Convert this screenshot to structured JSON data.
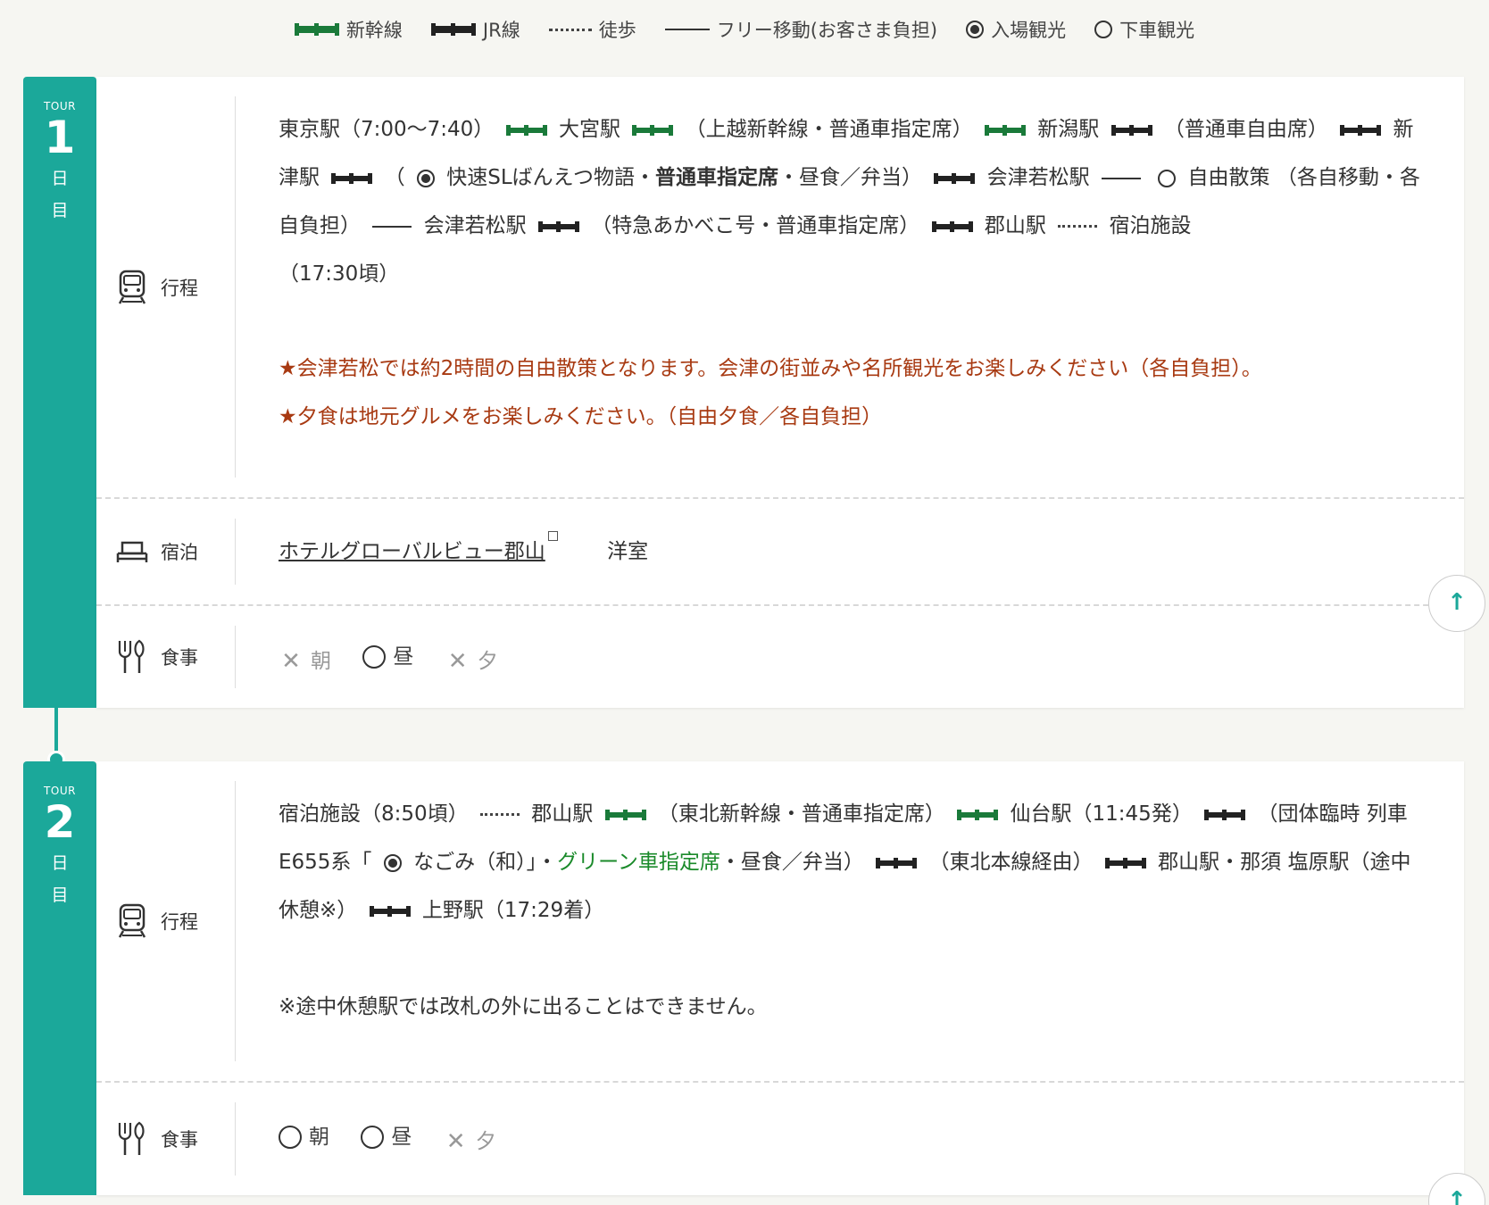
{
  "legend": {
    "shinkansen": "新幹線",
    "jr": "JR線",
    "walk": "徒歩",
    "free": "フリー移動(お客さま負担)",
    "entry": "入場観光",
    "stopover": "下車観光"
  },
  "colors": {
    "accent": "#1ba89a",
    "shinkansen": "#1a7a3a",
    "note": "#a83a12",
    "green_seat": "#1a8a2a"
  },
  "day1": {
    "tour": "TOUR",
    "num": "1",
    "nichi1": "日",
    "nichi2": "目",
    "itinerary_label": "行程",
    "route": {
      "a": "東京駅（7:00～7:40）",
      "b": "大宮駅",
      "c": "（上越新幹線・普通車指定席）",
      "d": "新潟駅",
      "e": "（普通車自由席）",
      "f": "新津駅",
      "g": "（",
      "h": "快速SLばんえつ物語・",
      "h2": "普通車指定席",
      "h3": "・昼食／弁当）",
      "i": "会津若松駅",
      "j": "自由散策",
      "k": "（各自移動・各自負担）",
      "l": "会津若松駅",
      "m": "（特急あかべこ号・普通車指定席）",
      "n": "郡山駅",
      "o": "宿泊施設",
      "p": "（17:30頃）"
    },
    "note1": "★会津若松では約2時間の自由散策となります。会津の街並みや名所観光をお楽しみください（各自負担）。",
    "note2": "★夕食は地元グルメをお楽しみください。（自由夕食／各自負担）",
    "stay_label": "宿泊",
    "hotel": "ホテルグローバルビュー郡山",
    "room": "洋室",
    "meal_label": "食事",
    "meals": {
      "breakfast": "朝",
      "lunch": "昼",
      "dinner": "夕"
    }
  },
  "day2": {
    "tour": "TOUR",
    "num": "2",
    "nichi1": "日",
    "nichi2": "目",
    "itinerary_label": "行程",
    "route": {
      "a": "宿泊施設（8:50頃）",
      "b": "郡山駅",
      "c": "（東北新幹線・普通車指定席）",
      "d": "仙台駅（11:45発）",
      "e": "（団体臨時",
      "e2": "列車E655系「",
      "f": "なごみ（和）」・",
      "g": "グリーン車指定席",
      "h": "・昼食／弁当）",
      "i": "（東北本線経由）",
      "j": "郡山駅・那須",
      "k": "塩原駅（途中休憩※）",
      "l": "上野駅（17:29着）"
    },
    "note": "※途中休憩駅では改札の外に出ることはできません。",
    "meal_label": "食事",
    "meals": {
      "breakfast": "朝",
      "lunch": "昼",
      "dinner": "夕"
    }
  }
}
